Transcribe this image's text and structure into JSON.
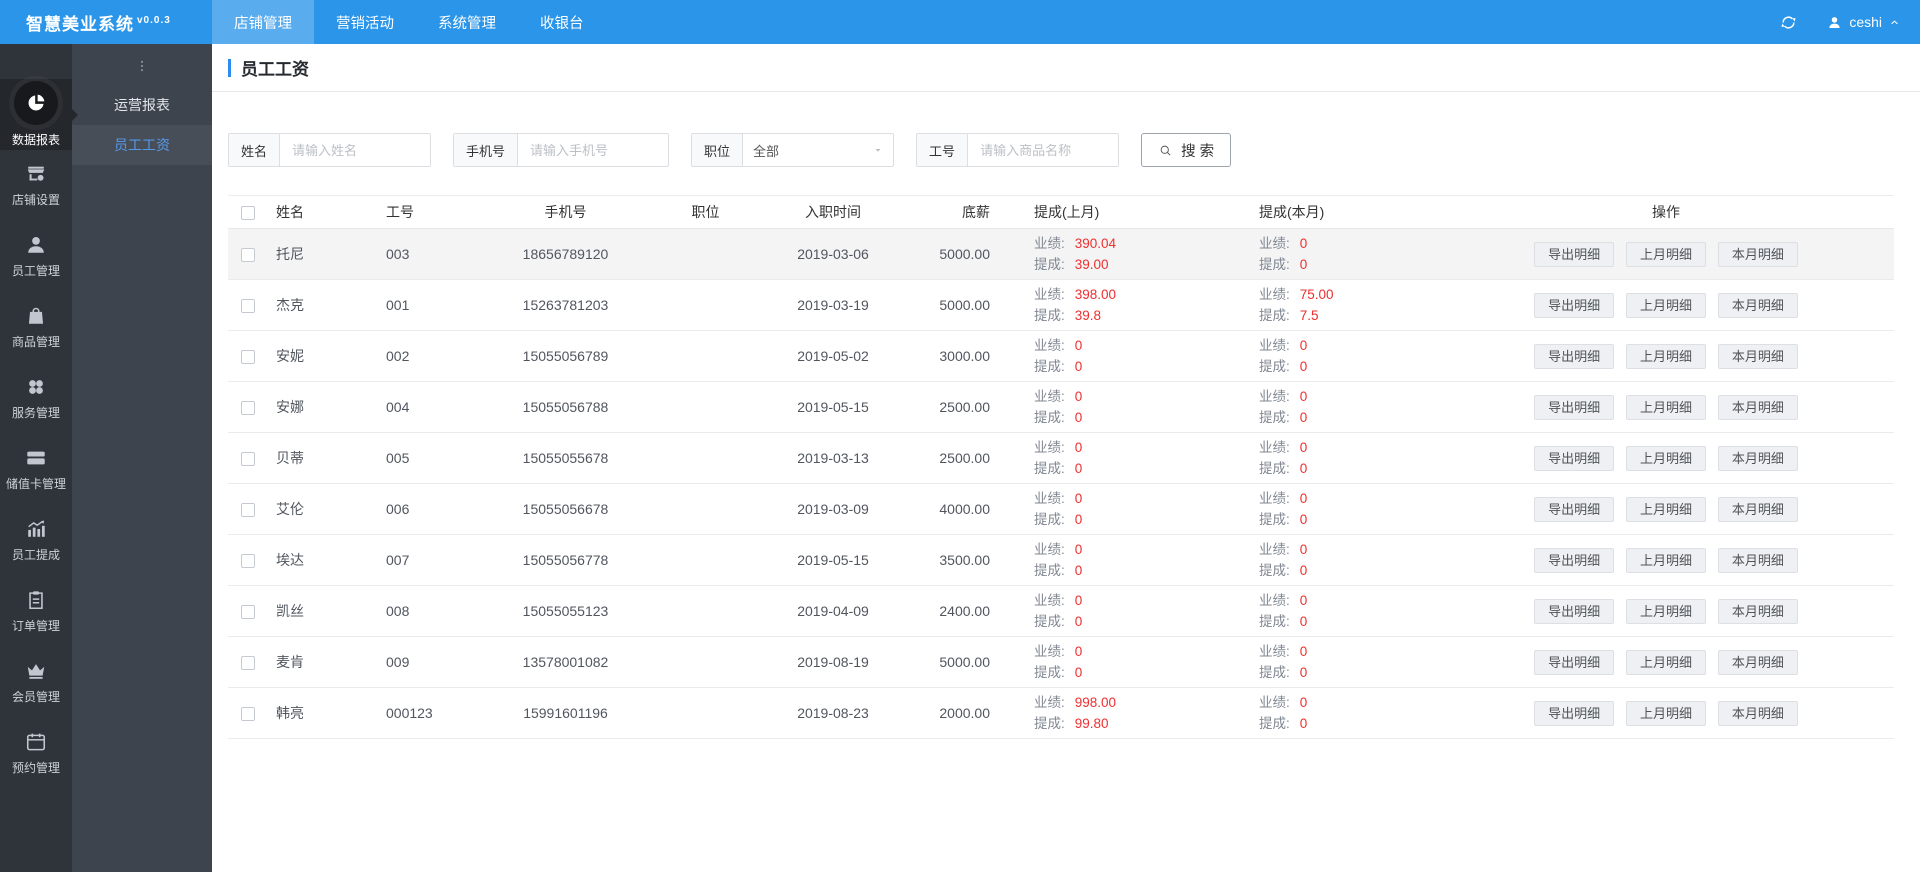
{
  "colors": {
    "topbar": "#2b95e9",
    "accent": "#2d8cf0",
    "danger": "#ee2f2f",
    "sidebar_bg": "#2f343a",
    "submenu_bg": "#3e444d"
  },
  "topbar": {
    "app_name": "智慧美业系统",
    "version": "v0.0.3",
    "tabs": [
      {
        "label": "店铺管理",
        "active": true
      },
      {
        "label": "营销活动",
        "active": false
      },
      {
        "label": "系统管理",
        "active": false
      },
      {
        "label": "收银台",
        "active": false
      }
    ],
    "refresh_icon": "refresh",
    "user": {
      "icon": "user",
      "name": "ceshi",
      "caret_icon": "caret-up"
    }
  },
  "sidebar": {
    "items": [
      {
        "label": "数据报表",
        "icon": "pie-chart",
        "active": true
      },
      {
        "label": "店铺设置",
        "icon": "storefront-gear",
        "active": false
      },
      {
        "label": "员工管理",
        "icon": "person",
        "active": false
      },
      {
        "label": "商品管理",
        "icon": "shopping-bag",
        "active": false
      },
      {
        "label": "服务管理",
        "icon": "four-circles",
        "active": false
      },
      {
        "label": "储值卡管理",
        "icon": "credit-card",
        "active": false
      },
      {
        "label": "员工提成",
        "icon": "chart-rise",
        "active": false
      },
      {
        "label": "订单管理",
        "icon": "clipboard",
        "active": false
      },
      {
        "label": "会员管理",
        "icon": "crown",
        "active": false
      },
      {
        "label": "预约管理",
        "icon": "calendar",
        "active": false
      }
    ]
  },
  "submenu": {
    "more_icon": "vertical-dots",
    "items": [
      {
        "label": "运营报表",
        "active": false
      },
      {
        "label": "员工工资",
        "active": true
      }
    ]
  },
  "page": {
    "title": "员工工资"
  },
  "filters": {
    "name": {
      "label": "姓名",
      "placeholder": "请输入姓名",
      "value": ""
    },
    "phone": {
      "label": "手机号",
      "placeholder": "请输入手机号",
      "value": ""
    },
    "position": {
      "label": "职位",
      "value": "全部",
      "caret_icon": "caret-down"
    },
    "job_no": {
      "label": "工号",
      "placeholder": "请输入商品名称",
      "value": ""
    },
    "search": {
      "label": "搜 索",
      "icon": "search"
    }
  },
  "table": {
    "columns": [
      "姓名",
      "工号",
      "手机号",
      "职位",
      "入职时间",
      "底薪",
      "提成(上月)",
      "提成(本月)",
      "操作"
    ],
    "perf_label": "业绩:",
    "comm_label": "提成:",
    "action_labels": [
      "导出明细",
      "上月明细",
      "本月明细"
    ],
    "rows": [
      {
        "name": "托尼",
        "job_no": "003",
        "phone": "18656789120",
        "position": "",
        "hire_date": "2019-03-06",
        "base_salary": "5000.00",
        "last_month": {
          "perf": "390.04",
          "comm": "39.00"
        },
        "this_month": {
          "perf": "0",
          "comm": "0"
        },
        "highlight": true
      },
      {
        "name": "杰克",
        "job_no": "001",
        "phone": "15263781203",
        "position": "",
        "hire_date": "2019-03-19",
        "base_salary": "5000.00",
        "last_month": {
          "perf": "398.00",
          "comm": "39.8"
        },
        "this_month": {
          "perf": "75.00",
          "comm": "7.5"
        },
        "highlight": false
      },
      {
        "name": "安妮",
        "job_no": "002",
        "phone": "15055056789",
        "position": "",
        "hire_date": "2019-05-02",
        "base_salary": "3000.00",
        "last_month": {
          "perf": "0",
          "comm": "0"
        },
        "this_month": {
          "perf": "0",
          "comm": "0"
        },
        "highlight": false
      },
      {
        "name": "安娜",
        "job_no": "004",
        "phone": "15055056788",
        "position": "",
        "hire_date": "2019-05-15",
        "base_salary": "2500.00",
        "last_month": {
          "perf": "0",
          "comm": "0"
        },
        "this_month": {
          "perf": "0",
          "comm": "0"
        },
        "highlight": false
      },
      {
        "name": "贝蒂",
        "job_no": "005",
        "phone": "15055055678",
        "position": "",
        "hire_date": "2019-03-13",
        "base_salary": "2500.00",
        "last_month": {
          "perf": "0",
          "comm": "0"
        },
        "this_month": {
          "perf": "0",
          "comm": "0"
        },
        "highlight": false
      },
      {
        "name": "艾伦",
        "job_no": "006",
        "phone": "15055056678",
        "position": "",
        "hire_date": "2019-03-09",
        "base_salary": "4000.00",
        "last_month": {
          "perf": "0",
          "comm": "0"
        },
        "this_month": {
          "perf": "0",
          "comm": "0"
        },
        "highlight": false
      },
      {
        "name": "埃达",
        "job_no": "007",
        "phone": "15055056778",
        "position": "",
        "hire_date": "2019-05-15",
        "base_salary": "3500.00",
        "last_month": {
          "perf": "0",
          "comm": "0"
        },
        "this_month": {
          "perf": "0",
          "comm": "0"
        },
        "highlight": false
      },
      {
        "name": "凯丝",
        "job_no": "008",
        "phone": "15055055123",
        "position": "",
        "hire_date": "2019-04-09",
        "base_salary": "2400.00",
        "last_month": {
          "perf": "0",
          "comm": "0"
        },
        "this_month": {
          "perf": "0",
          "comm": "0"
        },
        "highlight": false
      },
      {
        "name": "麦肯",
        "job_no": "009",
        "phone": "13578001082",
        "position": "",
        "hire_date": "2019-08-19",
        "base_salary": "5000.00",
        "last_month": {
          "perf": "0",
          "comm": "0"
        },
        "this_month": {
          "perf": "0",
          "comm": "0"
        },
        "highlight": false
      },
      {
        "name": "韩亮",
        "job_no": "000123",
        "phone": "15991601196",
        "position": "",
        "hire_date": "2019-08-23",
        "base_salary": "2000.00",
        "last_month": {
          "perf": "998.00",
          "comm": "99.80"
        },
        "this_month": {
          "perf": "0",
          "comm": "0"
        },
        "highlight": false
      }
    ]
  }
}
